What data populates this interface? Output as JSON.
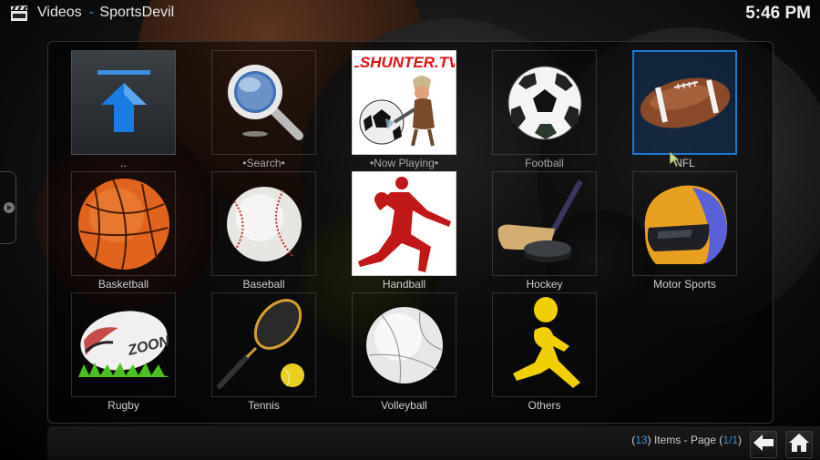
{
  "header": {
    "section": "Videos",
    "separator": "-",
    "addon": "SportsDevil",
    "icon": "clapperboard-icon",
    "clock": "5:46 PM"
  },
  "side_tab": {
    "icon": "play-arrow-icon"
  },
  "grid": {
    "items": [
      {
        "label": "..",
        "icon": "parent-folder-arrow-icon",
        "focused": false
      },
      {
        "label": "•Search•",
        "icon": "magnifier-icon",
        "focused": false
      },
      {
        "label": "•Now Playing•",
        "icon": "lshunter-tv-logo",
        "logo_text": "LSHUNTER.TV",
        "focused": false
      },
      {
        "label": "Football",
        "icon": "soccer-ball-icon",
        "focused": false
      },
      {
        "label": "NFL",
        "icon": "american-football-icon",
        "focused": true
      },
      {
        "label": "Basketball",
        "icon": "basketball-icon",
        "focused": false
      },
      {
        "label": "Baseball",
        "icon": "baseball-icon",
        "focused": false
      },
      {
        "label": "Handball",
        "icon": "handball-player-icon",
        "focused": false
      },
      {
        "label": "Hockey",
        "icon": "hockey-stick-puck-icon",
        "focused": false
      },
      {
        "label": "Motor Sports",
        "icon": "racing-helmet-icon",
        "focused": false
      },
      {
        "label": "Rugby",
        "icon": "rugby-ball-icon",
        "logo_text": "ZOON",
        "focused": false
      },
      {
        "label": "Tennis",
        "icon": "tennis-racket-ball-icon",
        "focused": false
      },
      {
        "label": "Volleyball",
        "icon": "volleyball-icon",
        "focused": false
      },
      {
        "label": "Others",
        "icon": "running-figure-icon",
        "focused": false
      }
    ]
  },
  "footer": {
    "count": "13",
    "items_text": "Items - Page",
    "page": "1/1",
    "back_icon": "back-arrow-icon",
    "home_icon": "home-icon"
  },
  "colors": {
    "accent": "#1e78d2",
    "accent_text": "#3a8fd8"
  }
}
